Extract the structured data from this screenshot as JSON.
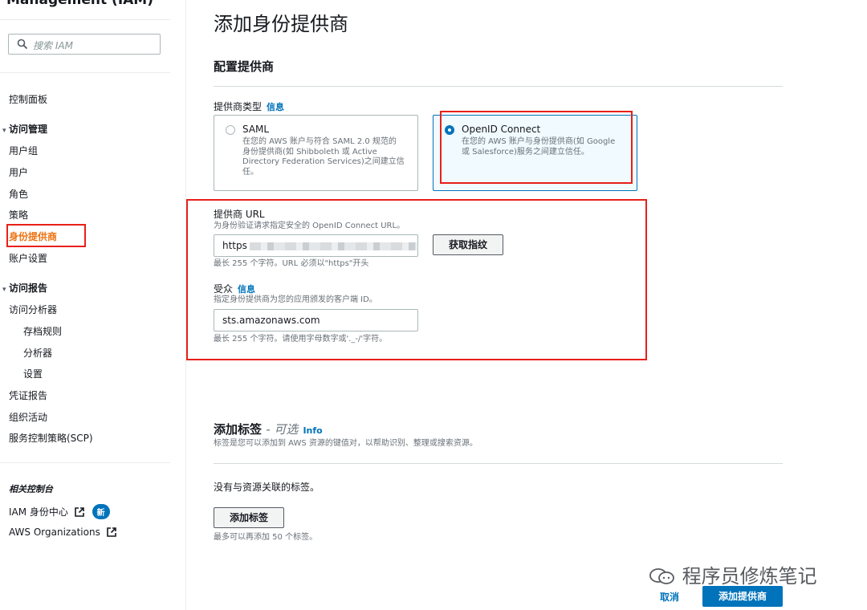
{
  "sidebar": {
    "title": "Management (IAM)",
    "search_placeholder": "搜索 IAM",
    "dashboard": "控制面板",
    "access_mgmt": "访问管理",
    "items": [
      "用户组",
      "用户",
      "角色",
      "策略",
      "身份提供商",
      "账户设置"
    ],
    "access_reports": "访问报告",
    "analyzer": "访问分析器",
    "analyzer_sub": [
      "存档规则",
      "分析器",
      "设置"
    ],
    "more": [
      "凭证报告",
      "组织活动",
      "服务控制策略(SCP)"
    ],
    "related": "相关控制台",
    "identity_center": "IAM 身份中心",
    "new_badge": "新",
    "organizations": "AWS Organizations"
  },
  "main": {
    "title": "添加身份提供商",
    "section": "配置提供商",
    "provider_type_label": "提供商类型",
    "info": "信息",
    "saml": {
      "title": "SAML",
      "desc_lines": [
        "在您的 AWS 账户与符合 SAML 2.0 规范的",
        "身份提供商(如 Shibboleth 或 Active",
        "Directory Federation Services)之间建立信",
        "任。"
      ]
    },
    "oidc": {
      "title": "OpenID Connect",
      "desc_lines": [
        "在您的 AWS 账户与身份提供商(如 Google",
        "或 Salesforce)服务之间建立信任。"
      ]
    },
    "url_label": "提供商 URL",
    "url_desc": "为身份验证请求指定安全的 OpenID Connect URL。",
    "url_value": "https",
    "thumbprint_button": "获取指纹",
    "url_hint": "最长 255 个字符。URL 必须以\"https\"开头",
    "audience_label": "受众",
    "audience_desc": "指定身份提供商为您的应用颁发的客户端 ID。",
    "audience_value": "sts.amazonaws.com",
    "audience_hint": "最长 255 个字符。请使用字母数字或'._-/'字符。",
    "tags_title": "添加标签",
    "tags_optional": "- 可选",
    "tags_info": "Info",
    "tags_desc": "标签是您可以添加到 AWS 资源的键值对，以帮助识别、整理或搜索资源。",
    "no_tags": "没有与资源关联的标签。",
    "add_tag_button": "添加标签",
    "tags_hint": "最多可以再添加 50 个标签。",
    "cancel": "取消",
    "submit": "添加提供商"
  },
  "watermark": "程序员修炼笔记",
  "colors": {
    "accent": "#0073bb",
    "active_nav": "#ec7211",
    "highlight_box": "#e8201a"
  }
}
